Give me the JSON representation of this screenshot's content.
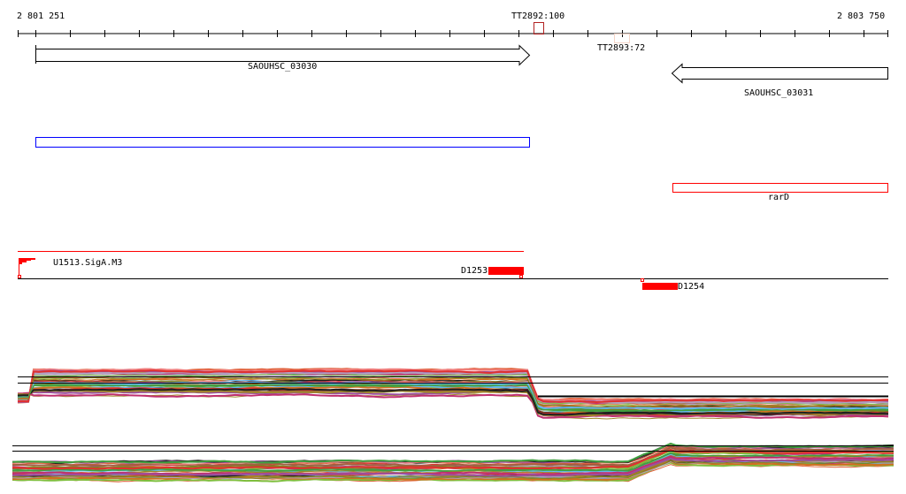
{
  "ruler": {
    "start_label": "2 801 251",
    "end_label": "2 803 750"
  },
  "terminators": [
    {
      "label": "TT2892:100",
      "color": "#b22222"
    },
    {
      "label": "TT2893:72",
      "color": "#f5d5c8"
    }
  ],
  "genes": [
    {
      "label": "SAOUHSC_03030",
      "strand": "+"
    },
    {
      "label": "SAOUHSC_03031",
      "strand": "-"
    }
  ],
  "annotations": {
    "blue_feature_color": "#0000ff",
    "rarD_label": "rarD",
    "rarD_color": "#ff0000"
  },
  "promoters": {
    "label": "U1513.SigA.M3",
    "color": "#ff0000"
  },
  "segments": [
    {
      "label": "D1253"
    },
    {
      "label": "D1254"
    }
  ],
  "palette": [
    "#e0603a",
    "#a0882a",
    "#7fbf3f",
    "#c03070",
    "#60b8f0",
    "#d07020",
    "#9a50a0",
    "#202020",
    "#b0a0c0",
    "#e03030",
    "#808020",
    "#40a040",
    "#a06040",
    "#f08080"
  ]
}
